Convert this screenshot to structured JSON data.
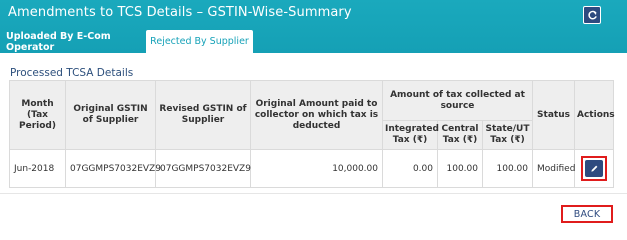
{
  "header": {
    "title": "Amendments to TCS Details – GSTIN-Wise-Summary",
    "refresh_icon": "refresh-icon"
  },
  "tabs": [
    {
      "label": "Uploaded By E-Com Operator",
      "active": false
    },
    {
      "label": "Rejected By Supplier",
      "active": true
    }
  ],
  "section": {
    "title": "Processed TCSA Details"
  },
  "table": {
    "headers": {
      "month": "Month (Tax Period)",
      "orig_gstin": "Original GSTIN of Supplier",
      "revised_gstin": "Revised GSTIN of Supplier",
      "orig_amount": "Original Amount paid to collector on which tax is deducted",
      "tax_group": "Amount of tax collected at source",
      "integrated": "Integrated Tax (₹)",
      "central": "Central Tax (₹)",
      "state": "State/UT Tax (₹)",
      "status": "Status",
      "actions": "Actions"
    },
    "rows": [
      {
        "month": "Jun-2018",
        "orig_gstin": "07GGMPS7032EVZ9",
        "revised_gstin": "07GGMPS7032EVZ9",
        "orig_amount": "10,000.00",
        "integrated": "0.00",
        "central": "100.00",
        "state": "100.00",
        "status": "Modified",
        "action_icon": "pencil-icon"
      }
    ]
  },
  "footer": {
    "back_label": "BACK"
  },
  "colors": {
    "header_bg": "#17a2b8",
    "button_navy": "#2e4a7f",
    "highlight_red": "#e01c1c",
    "link_blue": "#2c5fb8"
  }
}
